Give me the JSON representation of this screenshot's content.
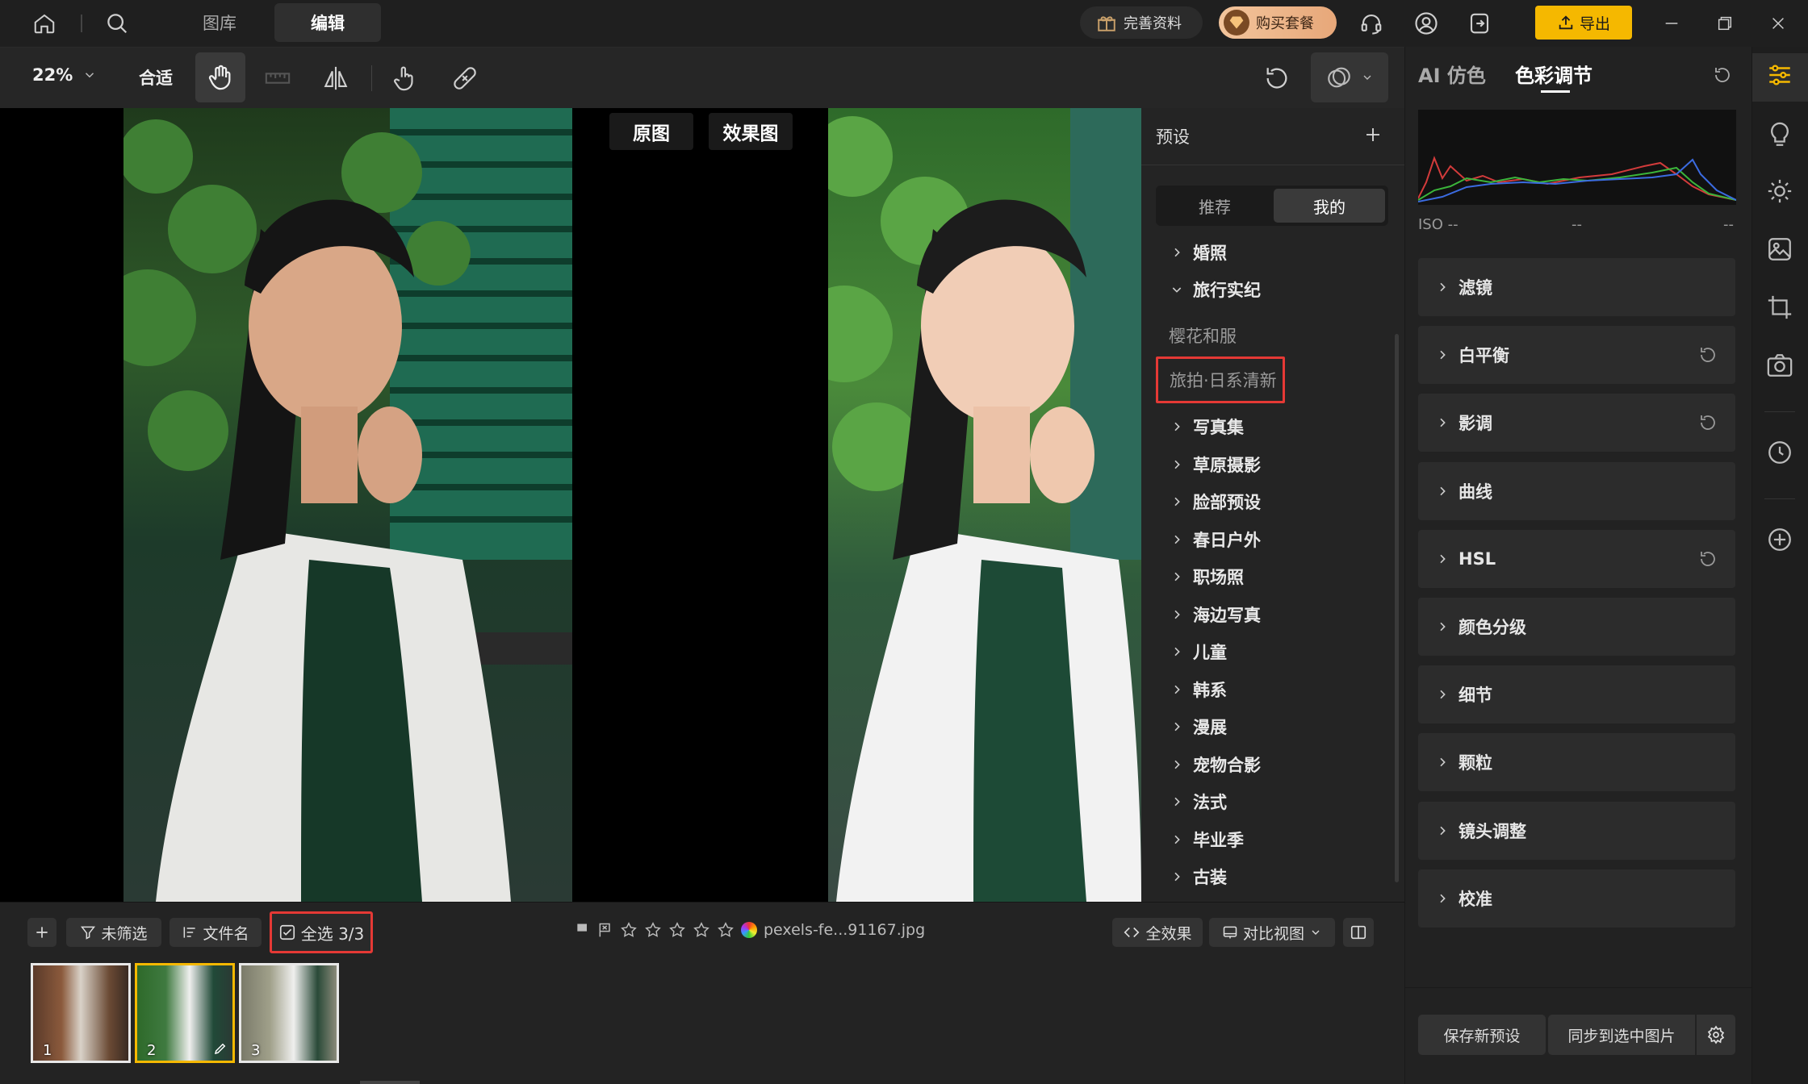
{
  "titlebar": {
    "tabs": [
      {
        "label": "图库"
      },
      {
        "label": "编辑"
      }
    ],
    "profile_btn": "完善资料",
    "buy_btn": "购买套餐",
    "export_btn": "导出"
  },
  "toolbar": {
    "zoom": "22%",
    "fit": "合适"
  },
  "canvas": {
    "before_label": "原图",
    "after_label": "效果图"
  },
  "presets": {
    "title": "预设",
    "tabs": [
      {
        "label": "推荐"
      },
      {
        "label": "我的"
      }
    ],
    "groups_top": [
      {
        "label": "婚照",
        "open": false
      },
      {
        "label": "旅行实纪",
        "open": true
      }
    ],
    "sub_items": [
      {
        "label": "樱花和服"
      },
      {
        "label": "旅拍·日系清新"
      }
    ],
    "groups": [
      {
        "label": "写真集"
      },
      {
        "label": "草原摄影"
      },
      {
        "label": "脸部预设"
      },
      {
        "label": "春日户外"
      },
      {
        "label": "职场照"
      },
      {
        "label": "海边写真"
      },
      {
        "label": "儿童"
      },
      {
        "label": "韩系"
      },
      {
        "label": "漫展"
      },
      {
        "label": "宠物合影"
      },
      {
        "label": "法式"
      },
      {
        "label": "毕业季"
      },
      {
        "label": "古装"
      }
    ]
  },
  "right_panel": {
    "tabs": [
      {
        "label": "AI 仿色"
      },
      {
        "label": "色彩调节"
      }
    ],
    "histogram": {
      "iso": "ISO --",
      "mid": "--",
      "right": "--"
    },
    "sections": [
      {
        "label": "滤镜",
        "reset": false
      },
      {
        "label": "白平衡",
        "reset": true
      },
      {
        "label": "影调",
        "reset": true
      },
      {
        "label": "曲线",
        "reset": false
      },
      {
        "label": "HSL",
        "reset": true
      },
      {
        "label": "颜色分级",
        "reset": false
      },
      {
        "label": "细节",
        "reset": false
      },
      {
        "label": "颗粒",
        "reset": false
      },
      {
        "label": "镜头调整",
        "reset": false
      },
      {
        "label": "校准",
        "reset": false
      }
    ],
    "save_preset": "保存新预设",
    "sync": "同步到选中图片"
  },
  "bottom": {
    "filter": "未筛选",
    "sort": "文件名",
    "select_all": "全选 3/3",
    "filename": "pexels-fe...91167.jpg",
    "all_effects": "全效果",
    "compare_view": "对比视图",
    "thumbs": [
      {
        "num": "1"
      },
      {
        "num": "2"
      },
      {
        "num": "3"
      }
    ]
  },
  "colors": {
    "accent": "#f5b800",
    "highlight_box": "#e53935",
    "buy": "#f0b48a"
  }
}
